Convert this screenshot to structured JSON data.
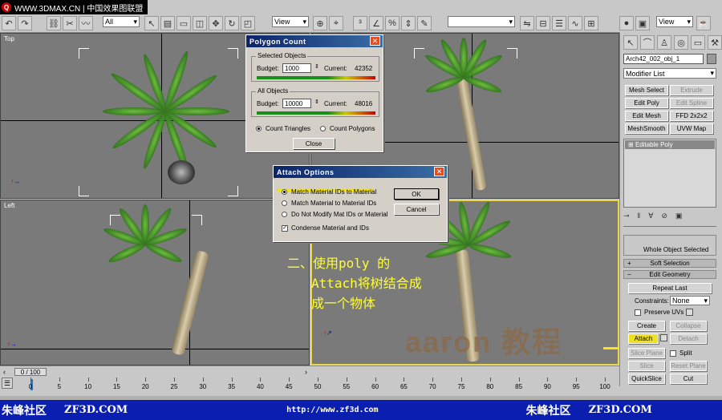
{
  "toolbar": {
    "brand_text": "WWW.3DMAX.CN | 中国效果图联盟",
    "selection_filter": "All",
    "ref_coord": "View",
    "named_set": "",
    "view_select": "View"
  },
  "viewports": {
    "top_label": "Top",
    "left_label": "Left"
  },
  "polygon_count": {
    "title": "Polygon Count",
    "selected_group": "Selected Objects",
    "all_group": "All Objects",
    "budget_label": "Budget:",
    "current_label": "Current:",
    "selected_budget": "1000",
    "selected_current": "42352",
    "all_budget": "10000",
    "all_current": "48016",
    "count_triangles": "Count Triangles",
    "count_polygons": "Count Polygons",
    "close": "Close"
  },
  "attach_options": {
    "title": "Attach Options",
    "opt1": "Match Material IDs to Material",
    "opt2": "Match Material to Material IDs",
    "opt3": "Do Not Modify Mat IDs or Material",
    "condense": "Condense Material and IDs",
    "ok": "OK",
    "cancel": "Cancel"
  },
  "annotation": {
    "line1": "二、使用poly 的",
    "line2": "Attach将树结合成",
    "line3": "成一个物体",
    "watermark": "aaron 教程"
  },
  "panel": {
    "object_name": "Arch42_002_obj_1",
    "modifier_list": "Modifier List",
    "mesh_select": "Mesh Select",
    "extrude": "Extrude",
    "edit_poly": "Edit Poly",
    "edit_spline": "Edit Spline",
    "edit_mesh": "Edit Mesh",
    "ffd": "FFD 2x2x2",
    "meshsmooth": "MeshSmooth",
    "uvw_map": "UVW Map",
    "stack_item": "Editable Poly",
    "whole_selected": "Whole Object Selected",
    "soft_selection": "Soft Selection",
    "edit_geometry": "Edit Geometry",
    "repeat_last": "Repeat Last",
    "constraints_label": "Constraints:",
    "constraints_value": "None",
    "preserve_uvs": "Preserve UVs",
    "create": "Create",
    "collapse": "Collapse",
    "attach": "Attach",
    "detach": "Detach",
    "slice_plane": "Slice Plane",
    "split": "Split",
    "slice": "Slice",
    "reset_plane": "Reset Plane",
    "quickslice": "QuickSlice",
    "cut": "Cut"
  },
  "timeline": {
    "frame": "0 / 100",
    "ticks": [
      "0",
      "5",
      "10",
      "15",
      "20",
      "25",
      "30",
      "35",
      "40",
      "45",
      "50",
      "55",
      "60",
      "65",
      "70",
      "75",
      "80",
      "85",
      "90",
      "95",
      "100"
    ]
  },
  "footer": {
    "left_brand": "朱峰社区",
    "left_site": "ZF3D.COM",
    "url": "http://www.zf3d.com",
    "right_brand": "朱峰社区",
    "right_site": "ZF3D.COM"
  },
  "colors": {
    "footer_bg": "#0a1fb0",
    "title_bar": "#0a246a",
    "active_viewport": "#e8d84a",
    "annotation": "#ffff33"
  }
}
